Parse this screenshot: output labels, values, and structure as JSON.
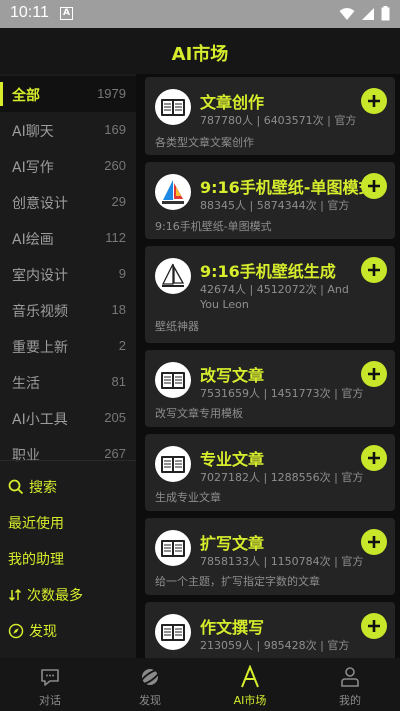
{
  "status_bar": {
    "time": "10:11",
    "notification_letter": "A"
  },
  "header": {
    "title": "AI市场"
  },
  "sidebar": {
    "categories": [
      {
        "label": "全部",
        "count": "1979"
      },
      {
        "label": "AI聊天",
        "count": "169"
      },
      {
        "label": "AI写作",
        "count": "260"
      },
      {
        "label": "创意设计",
        "count": "29"
      },
      {
        "label": "AI绘画",
        "count": "112"
      },
      {
        "label": "室内设计",
        "count": "9"
      },
      {
        "label": "音乐视频",
        "count": "18"
      },
      {
        "label": "重要上新",
        "count": "2"
      },
      {
        "label": "生活",
        "count": "81"
      },
      {
        "label": "AI小工具",
        "count": "205"
      },
      {
        "label": "职业",
        "count": "267"
      }
    ],
    "links": {
      "search": "搜索",
      "recent": "最近使用",
      "my_assistant": "我的助理",
      "most_used": "次数最多",
      "discover": "发现"
    }
  },
  "cards": [
    {
      "title": "文章创作",
      "stats": "787780人 | 6403571次 | 官方",
      "desc": "各类型文章文案创作",
      "icon": "document-icon"
    },
    {
      "title": "9:16手机壁纸-单图模式",
      "stats": "88345人 | 5874344次 | 官方",
      "desc": "9:16手机壁纸-单图模式",
      "icon": "sailboat-icon"
    },
    {
      "title": "9:16手机壁纸生成",
      "stats": "42674人 | 4512072次 | And You Leon",
      "desc": "壁纸神器",
      "icon": "sailboat-sketch-icon"
    },
    {
      "title": "改写文章",
      "stats": "7531659人 | 1451773次 | 官方",
      "desc": "改写文章专用模板",
      "icon": "document-icon"
    },
    {
      "title": "专业文章",
      "stats": "7027182人 | 1288556次 | 官方",
      "desc": "生成专业文章",
      "icon": "document-icon"
    },
    {
      "title": "扩写文章",
      "stats": "7858133人 | 1150784次 | 官方",
      "desc": "给一个主题，扩写指定字数的文章",
      "icon": "document-icon"
    },
    {
      "title": "作文撰写",
      "stats": "213059人 | 985428次 | 官方",
      "desc": "",
      "icon": "document-icon"
    }
  ],
  "tabbar": {
    "tabs": [
      {
        "label": "对话",
        "icon": "chat-icon"
      },
      {
        "label": "发现",
        "icon": "planet-icon"
      },
      {
        "label": "AI市场",
        "icon": "letter-a-icon"
      },
      {
        "label": "我的",
        "icon": "person-icon"
      }
    ],
    "active": "AI市场"
  },
  "colors": {
    "accent": "#d6ec2c",
    "add_button": "#c8e62a",
    "background": "#121212",
    "card": "#242424"
  }
}
